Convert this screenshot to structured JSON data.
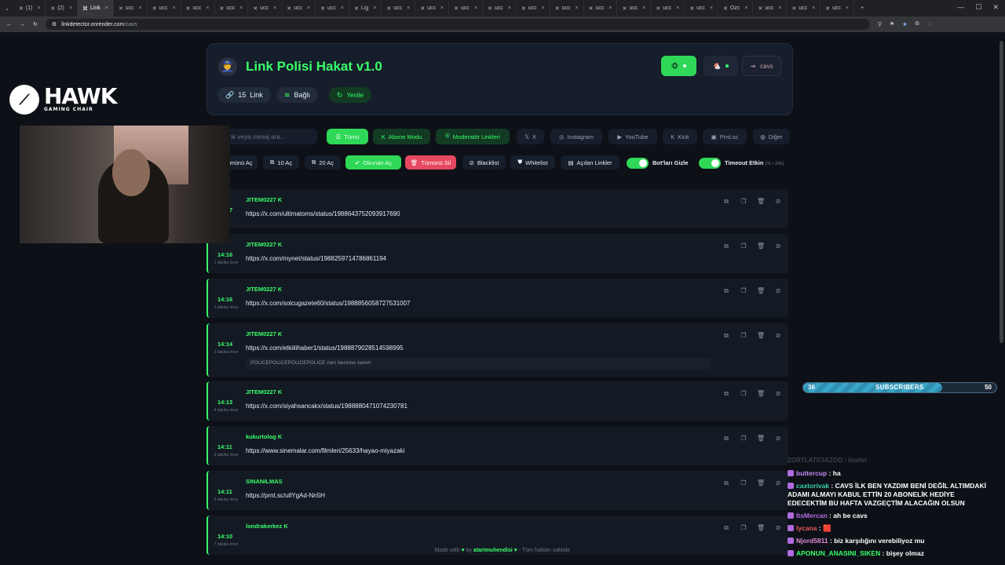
{
  "browser": {
    "tabs": [
      {
        "label": "(1)"
      },
      {
        "label": "(2)"
      },
      {
        "label": "Link",
        "active": true
      },
      {
        "label": "ucc"
      },
      {
        "label": "ucc"
      },
      {
        "label": "ucc"
      },
      {
        "label": "ucc"
      },
      {
        "label": "ucc"
      },
      {
        "label": "ucc"
      },
      {
        "label": "ucc"
      },
      {
        "label": "Lig"
      },
      {
        "label": "ucc"
      },
      {
        "label": "ucc"
      },
      {
        "label": "ucc"
      },
      {
        "label": "ucc"
      },
      {
        "label": "ucc"
      },
      {
        "label": "ucc"
      },
      {
        "label": "ucc"
      },
      {
        "label": "ucc"
      },
      {
        "label": "ucc"
      },
      {
        "label": "ucc"
      },
      {
        "label": "Ozc"
      },
      {
        "label": "ucc"
      },
      {
        "label": "ucc"
      },
      {
        "label": "ucc"
      }
    ],
    "url_host": "linkdetector.onrender.com",
    "url_path": "/cavs"
  },
  "header": {
    "title": "Link Polisi Hakat v1.0",
    "link_count": "15",
    "link_label": "Link",
    "status": "Bağlı",
    "refresh": "Yenile",
    "user_button": "cavs"
  },
  "search": {
    "placeholder": "ink veya mesaj ara..."
  },
  "filters": [
    {
      "label": "Tümü",
      "icon": "list-icon",
      "state": "active"
    },
    {
      "label": "Abone Modu",
      "icon": "kick-icon",
      "state": "green"
    },
    {
      "label": "Moderatör Linkleri",
      "icon": "user-shield-icon",
      "state": "green"
    },
    {
      "label": "X",
      "icon": "x-logo-icon",
      "state": "normal"
    },
    {
      "label": "Instagram",
      "icon": "instagram-icon",
      "state": "normal"
    },
    {
      "label": "YouTube",
      "icon": "youtube-icon",
      "state": "normal"
    },
    {
      "label": "Kick",
      "icon": "kick-icon",
      "state": "normal"
    },
    {
      "label": "Prnt.sc",
      "icon": "camera-icon",
      "state": "normal"
    },
    {
      "label": "Diğer",
      "icon": "globe-icon",
      "state": "normal"
    }
  ],
  "actions": [
    {
      "label": "ümünü Aç",
      "icon": "",
      "state": "normal"
    },
    {
      "label": "10 Aç",
      "icon": "external-link-icon",
      "state": "normal"
    },
    {
      "label": "20 Aç",
      "icon": "external-link-icon",
      "state": "normal"
    },
    {
      "label": "Okunan Aç",
      "icon": "check-circle-icon",
      "state": "green"
    },
    {
      "label": "Tümünü Sil",
      "icon": "trash-icon",
      "state": "red"
    },
    {
      "label": "Blacklist",
      "icon": "ban-icon",
      "state": "normal"
    },
    {
      "label": "Whitelist",
      "icon": "shield-icon",
      "state": "normal"
    },
    {
      "label": "Açılan Linkler",
      "icon": "box-icon",
      "state": "normal"
    }
  ],
  "toggles": {
    "bot_hide": {
      "label": "Bot'ları Gizle",
      "on": true
    },
    "timeout": {
      "label": "Timeout Etkin",
      "sub": "(% / 24s)",
      "on": true
    }
  },
  "links": [
    {
      "time": "14:17",
      "ago": "önce",
      "user": "JITEM0227",
      "kick": true,
      "url": "https://x.com/ultimatoms/status/1988643752093917690",
      "msg": ""
    },
    {
      "time": "14:16",
      "ago": "1 dakika önce",
      "user": "JITEM0227",
      "kick": true,
      "url": "https://x.com/mynet/status/1988259714786861194",
      "msg": ""
    },
    {
      "time": "14:16",
      "ago": "1 dakika önce",
      "user": "JITEM0227",
      "kick": true,
      "url": "https://x.com/solcugazete60/status/1988856058727531007",
      "msg": ""
    },
    {
      "time": "14:14",
      "ago": "3 dakika önce",
      "user": "JITEM0227",
      "kick": true,
      "url": "https://x.com/etkiilihaber1/status/1988879028514598995",
      "msg": "POLICEPOLICEPOLICEPOLICE zam benzine zamm"
    },
    {
      "time": "14:13",
      "ago": "4 dakika önce",
      "user": "JITEM0227",
      "kick": true,
      "url": "https://x.com/siyahsancakx/status/1988880471074230781",
      "msg": ""
    },
    {
      "time": "14:11",
      "ago": "6 dakika önce",
      "user": "kukurtolog",
      "kick": true,
      "url": "https://www.sinemalar.com/filmleri/25633/hayao-miyazaki",
      "msg": ""
    },
    {
      "time": "14:11",
      "ago": "6 dakika önce",
      "user": "SINANILMAS",
      "kick": false,
      "url": "https://prnt.sc/ullYgAd-Nn5H",
      "msg": ""
    },
    {
      "time": "14:10",
      "ago": "7 dakika önce",
      "user": "londrakerkez",
      "kick": true,
      "url": "",
      "msg": ""
    }
  ],
  "footer": {
    "prefix": "Made with",
    "by": "by",
    "author": "atarimuhendisi",
    "suffix": "- Tüm hakları saklıdır"
  },
  "overlay": {
    "brand": "HAWK",
    "brand_sub": "GAMING CHAIR",
    "subs": {
      "current": "36",
      "label": "SUBSCRIBERS",
      "goal": "50",
      "progress": 0.72
    },
    "chat": {
      "faded": "ZORTLATICIAZOO : tiraller",
      "messages": [
        {
          "user": "buttercup",
          "color": "#c58af9",
          "text": "ha"
        },
        {
          "user": "caxtorivak",
          "color": "#3ad1a6",
          "text": "CAVS İLK BEN YAZDIM BENİ DEĞİL ALTIMDAKİ ADAMI ALMAYI KABUL ETTİN 20 ABONELİK HEDİYE EDECEKTİM BU HAFTA VAZGEÇTİM ALACAĞIN OLSUN"
        },
        {
          "user": "ItsMercan",
          "color": "#b46be3",
          "text": "ah be cavs"
        },
        {
          "user": "lycana",
          "color": "#e85a5a",
          "text": "🟥"
        },
        {
          "user": "Njord5811",
          "color": "#e08ad6",
          "text": "biz karşılığını verebiliyoz mu"
        },
        {
          "user": "APONUN_ANASINI_SIKEN",
          "color": "#39ff6a",
          "text": "bişey olmaz"
        }
      ]
    }
  }
}
